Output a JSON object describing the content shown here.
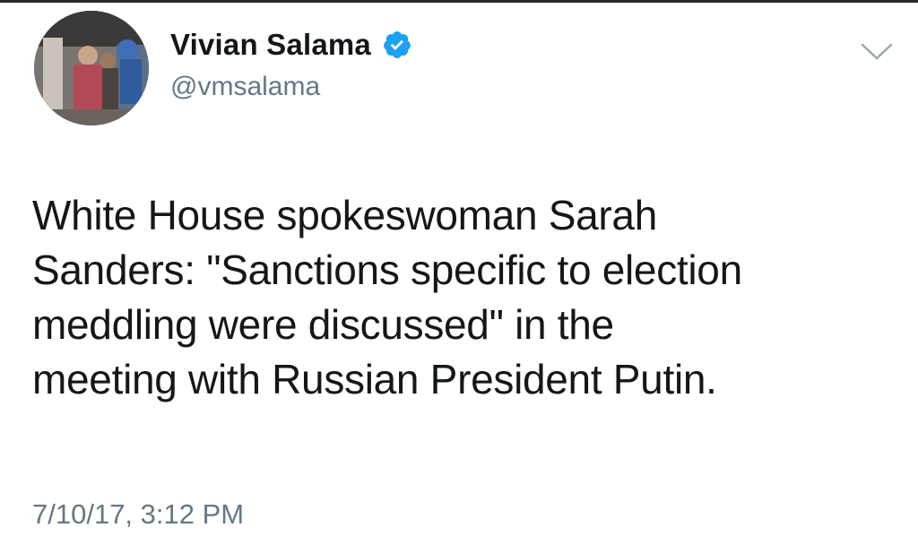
{
  "user": {
    "display_name": "Vivian Salama",
    "handle": "@vmsalama",
    "verified": true
  },
  "icons": {
    "verified": "verified-badge-icon",
    "caret": "chevron-down-icon",
    "avatar": "profile-photo"
  },
  "tweet": {
    "text": "White House spokeswoman Sarah\nSanders: \"Sanctions specific to election\nmeddling were discussed\" in the\nmeeting with Russian President Putin.",
    "timestamp": "7/10/17, 3:12 PM"
  },
  "colors": {
    "text": "#14171a",
    "secondary": "#657786",
    "verified_blue": "#1da1f2",
    "background": "#ffffff"
  }
}
